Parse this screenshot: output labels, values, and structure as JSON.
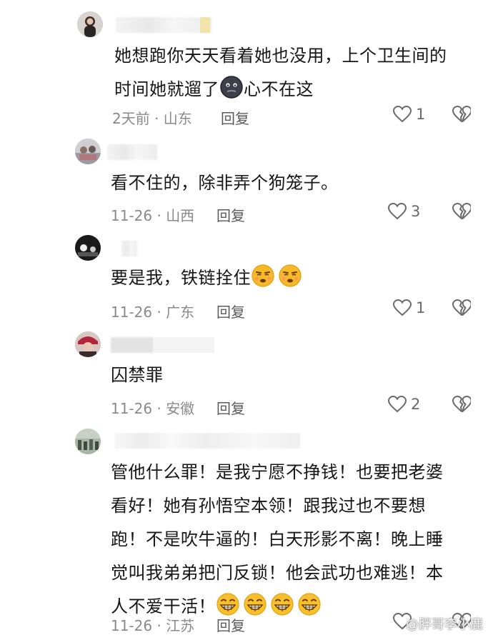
{
  "comments": [
    {
      "text_lines": [
        "她想跑你天天看着她也没用，上个卫生间的",
        "时间她就遛了"
      ],
      "text_suffix": "心不在这",
      "meta": "2天前 · 山东",
      "reply": "回复",
      "likes": "1",
      "emoji": "black-face-emoji"
    },
    {
      "text_lines": [
        "看不住的，除非弄个狗笼子。"
      ],
      "meta": "11-26 · 山西",
      "reply": "回复",
      "likes": "3"
    },
    {
      "text_lines": [
        "要是我，铁链拴住"
      ],
      "meta": "11-26 · 广东",
      "reply": "回复",
      "likes": "1",
      "emoji": "smirk-emoji"
    },
    {
      "text_lines": [
        "囚禁罪"
      ],
      "meta": "11-26 · 安徽",
      "reply": "回复",
      "likes": "2"
    },
    {
      "text_lines": [
        "管他什么罪！是我宁愿不挣钱！也要把老婆",
        "看好！她有孙悟空本领！跟我过也不要想",
        "跑！不是吹牛逼的！白天形影不离！晚上睡",
        "觉叫我弟弟把门反锁！他会武功也难逃！本",
        "人不爱干活！"
      ],
      "meta": "11-26 · 江苏",
      "reply": "回复",
      "emoji": "grin-emoji"
    }
  ],
  "watermark": "@胖哥李小鹿",
  "colors": {
    "text": "#161616",
    "meta": "#8a8a8a",
    "icon": "#6a6a6a"
  }
}
